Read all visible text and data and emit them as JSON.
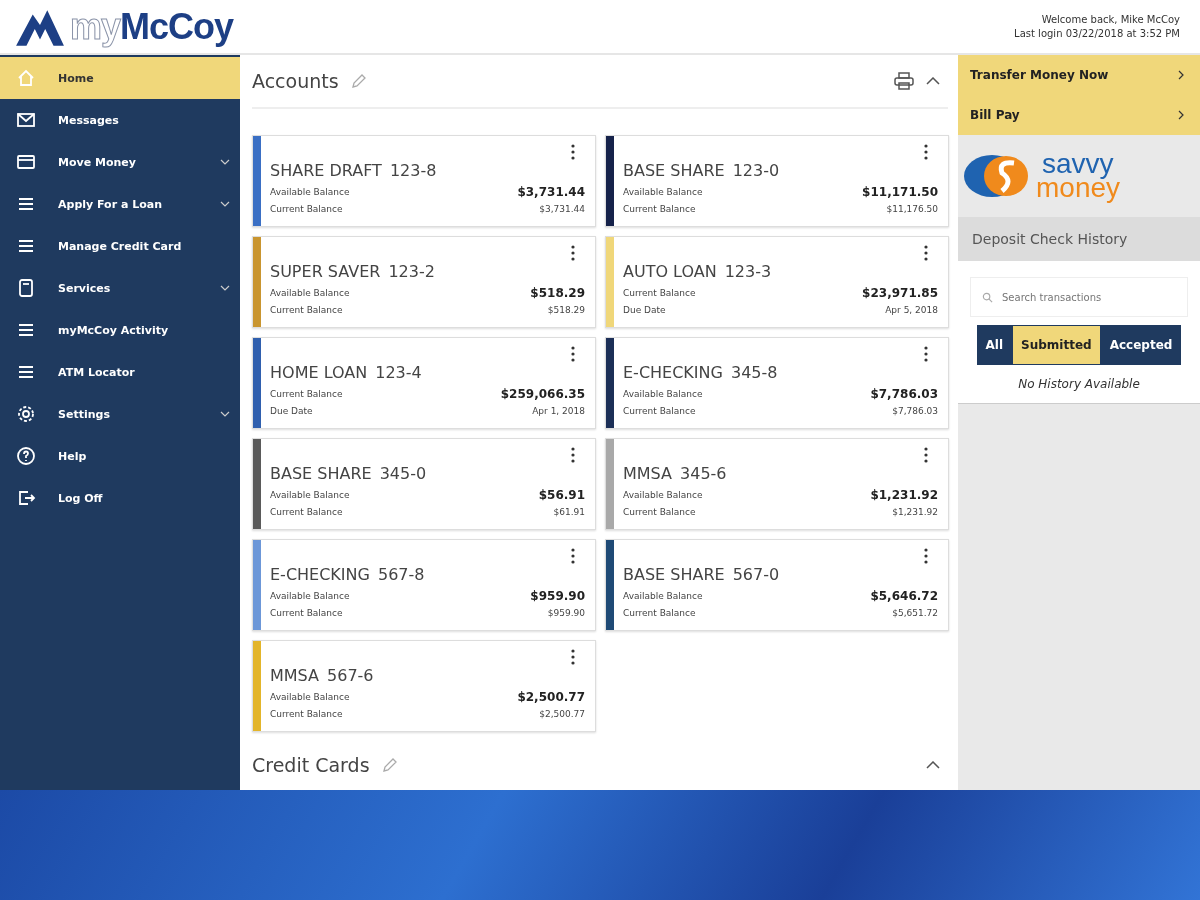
{
  "header": {
    "logo": {
      "prefix": "my",
      "name": "McCoy"
    },
    "welcome": "Welcome back, Mike McCoy",
    "last_login": "Last login 03/22/2018 at 3:52 PM"
  },
  "sidebar": {
    "items": [
      {
        "label": "Home",
        "kind": "home",
        "selected": true,
        "submenu": false
      },
      {
        "label": "Messages",
        "kind": "mail",
        "selected": false,
        "submenu": false
      },
      {
        "label": "Move Money",
        "kind": "card",
        "selected": false,
        "submenu": true
      },
      {
        "label": "Apply For a Loan",
        "kind": "list",
        "selected": false,
        "submenu": true
      },
      {
        "label": "Manage Credit Card",
        "kind": "list",
        "selected": false,
        "submenu": false
      },
      {
        "label": "Services",
        "kind": "calculator",
        "selected": false,
        "submenu": true
      },
      {
        "label": "myMcCoy Activity",
        "kind": "list",
        "selected": false,
        "submenu": false
      },
      {
        "label": "ATM Locator",
        "kind": "list",
        "selected": false,
        "submenu": false
      },
      {
        "label": "Settings",
        "kind": "gear",
        "selected": false,
        "submenu": true
      },
      {
        "label": "Help",
        "kind": "help",
        "selected": false,
        "submenu": false
      },
      {
        "label": "Log Off",
        "kind": "logout",
        "selected": false,
        "submenu": false
      }
    ]
  },
  "accounts": {
    "title": "Accounts",
    "expanded": true,
    "cards": [
      {
        "name": "SHARE DRAFT",
        "number": "123-8",
        "color": "#3a6fc4",
        "rows": [
          {
            "label": "Available Balance",
            "value": "$3,731.44"
          },
          {
            "label": "Current Balance",
            "value": "$3,731.44"
          }
        ]
      },
      {
        "name": "BASE SHARE",
        "number": "123-0",
        "color": "#16224a",
        "rows": [
          {
            "label": "Available Balance",
            "value": "$11,171.50"
          },
          {
            "label": "Current Balance",
            "value": "$11,176.50"
          }
        ]
      },
      {
        "name": "SUPER SAVER",
        "number": "123-2",
        "color": "#c9952f",
        "rows": [
          {
            "label": "Available Balance",
            "value": "$518.29"
          },
          {
            "label": "Current Balance",
            "value": "$518.29"
          }
        ]
      },
      {
        "name": "AUTO LOAN",
        "number": "123-3",
        "color": "#f0d77a",
        "rows": [
          {
            "label": "Current Balance",
            "value": "$23,971.85"
          },
          {
            "label": "Due Date",
            "value": "Apr 5, 2018"
          }
        ]
      },
      {
        "name": "HOME LOAN",
        "number": "123-4",
        "color": "#2f5fae",
        "rows": [
          {
            "label": "Current Balance",
            "value": "$259,066.35"
          },
          {
            "label": "Due Date",
            "value": "Apr 1, 2018"
          }
        ]
      },
      {
        "name": "E-CHECKING",
        "number": "345-8",
        "color": "#1c2f57",
        "rows": [
          {
            "label": "Available Balance",
            "value": "$7,786.03"
          },
          {
            "label": "Current Balance",
            "value": "$7,786.03"
          }
        ]
      },
      {
        "name": "BASE SHARE",
        "number": "345-0",
        "color": "#5a5a5a",
        "rows": [
          {
            "label": "Available Balance",
            "value": "$56.91"
          },
          {
            "label": "Current Balance",
            "value": "$61.91"
          }
        ]
      },
      {
        "name": "MMSA",
        "number": "345-6",
        "color": "#a9a9a9",
        "rows": [
          {
            "label": "Available Balance",
            "value": "$1,231.92"
          },
          {
            "label": "Current Balance",
            "value": "$1,231.92"
          }
        ]
      },
      {
        "name": "E-CHECKING",
        "number": "567-8",
        "color": "#6c97d8",
        "rows": [
          {
            "label": "Available Balance",
            "value": "$959.90"
          },
          {
            "label": "Current Balance",
            "value": "$959.90"
          }
        ]
      },
      {
        "name": "BASE SHARE",
        "number": "567-0",
        "color": "#1f4a76",
        "rows": [
          {
            "label": "Available Balance",
            "value": "$5,646.72"
          },
          {
            "label": "Current Balance",
            "value": "$5,651.72"
          }
        ]
      },
      {
        "name": "MMSA",
        "number": "567-6",
        "color": "#e3b52a",
        "rows": [
          {
            "label": "Available Balance",
            "value": "$2,500.77"
          },
          {
            "label": "Current Balance",
            "value": "$2,500.77"
          }
        ]
      }
    ]
  },
  "credit_cards": {
    "title": "Credit Cards",
    "expanded": true
  },
  "quick_links": [
    "Transfer Money Now",
    "Bill Pay"
  ],
  "savvy_logo": {
    "top": "savvy",
    "bottom": "money"
  },
  "deposit_history": {
    "title": "Deposit Check History",
    "search": {
      "placeholder": "Search transactions"
    },
    "filters": [
      {
        "label": "All",
        "selected": false
      },
      {
        "label": "Submitted",
        "selected": true
      },
      {
        "label": "Accepted",
        "selected": false
      }
    ],
    "empty": "No History Available"
  }
}
